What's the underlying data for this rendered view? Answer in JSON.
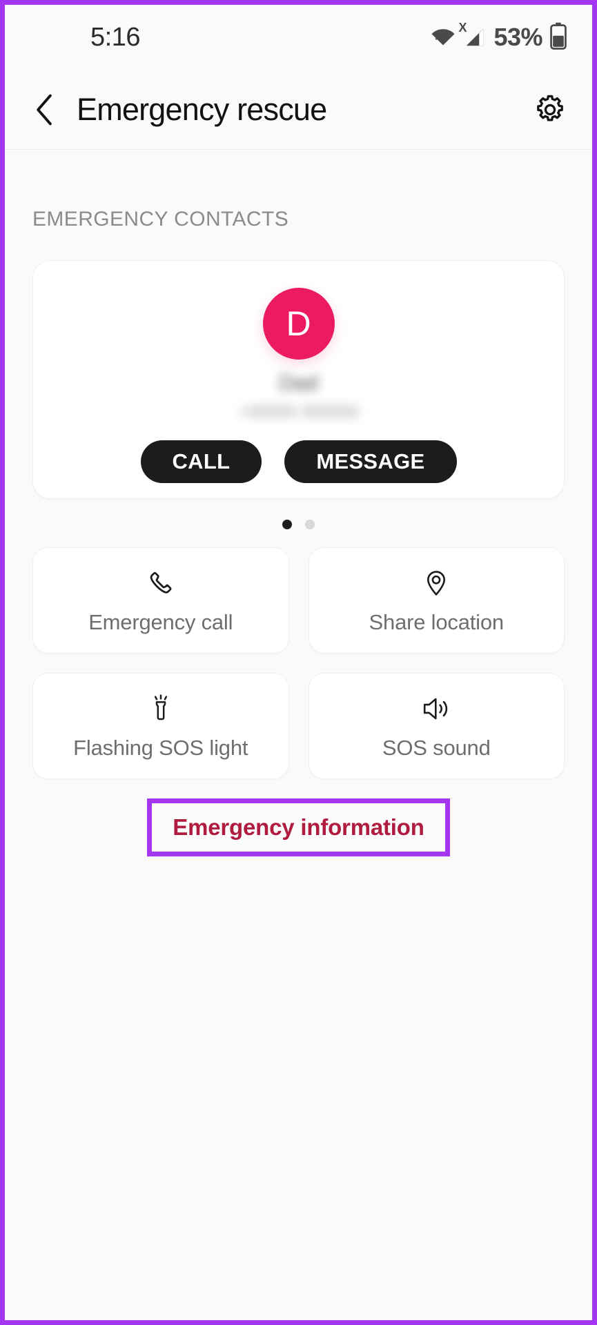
{
  "status_bar": {
    "time": "5:16",
    "battery_percent": "53%",
    "icons": {
      "wifi": "wifi-icon",
      "signal": "cellular-signal-no-sim-icon",
      "signal_badge": "X",
      "battery": "battery-icon"
    }
  },
  "app_bar": {
    "back": "back-chevron-icon",
    "title": "Emergency rescue",
    "settings": "gear-icon"
  },
  "main": {
    "section_label": "EMERGENCY CONTACTS",
    "contact": {
      "avatar_initial": "D",
      "avatar_color": "#ec1a5e",
      "name": "Dad",
      "number": "+00000 000000",
      "call_label": "CALL",
      "message_label": "MESSAGE"
    },
    "pager": {
      "count": 2,
      "active_index": 0
    },
    "tiles": [
      {
        "label": "Emergency call",
        "icon": "phone-icon"
      },
      {
        "label": "Share location",
        "icon": "location-pin-icon"
      },
      {
        "label": "Flashing SOS light",
        "icon": "flashlight-icon"
      },
      {
        "label": "SOS sound",
        "icon": "speaker-volume-icon"
      }
    ],
    "emergency_information": {
      "label": "Emergency information",
      "text_color": "#b01b40",
      "highlight_color": "#a435f0"
    }
  }
}
